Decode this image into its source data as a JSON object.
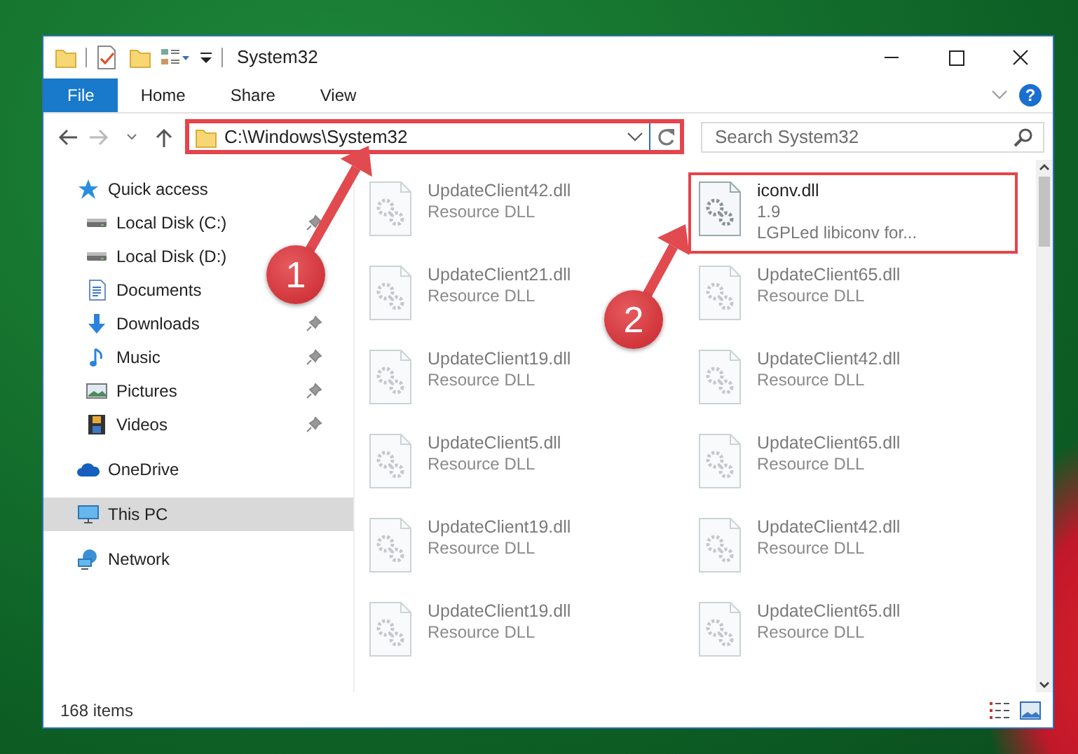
{
  "window": {
    "title": "System32"
  },
  "ribbon_tabs": [
    {
      "label": "File",
      "kind": "file"
    },
    {
      "label": "Home",
      "kind": "tab"
    },
    {
      "label": "Share",
      "kind": "tab"
    },
    {
      "label": "View",
      "kind": "tab"
    }
  ],
  "help_button": {
    "label": "?"
  },
  "address": {
    "path": "C:\\Windows\\System32",
    "highlighted": true
  },
  "search": {
    "placeholder": "Search System32"
  },
  "navigation": [
    {
      "label": "Quick access",
      "kind": "star",
      "selected": false,
      "children": [
        {
          "label": "Local Disk (C:)",
          "kind": "drive",
          "pinned": true,
          "selected": false
        },
        {
          "label": "Local Disk (D:)",
          "kind": "drive",
          "pinned": false,
          "selected": false
        },
        {
          "label": "Documents",
          "kind": "document",
          "pinned": false,
          "selected": false
        },
        {
          "label": "Downloads",
          "kind": "download",
          "pinned": true,
          "selected": false
        },
        {
          "label": "Music",
          "kind": "music",
          "pinned": true,
          "selected": false
        },
        {
          "label": "Pictures",
          "kind": "picture",
          "pinned": true,
          "selected": false
        },
        {
          "label": "Videos",
          "kind": "video",
          "pinned": true,
          "selected": false
        }
      ]
    },
    {
      "label": "OneDrive",
      "kind": "cloud",
      "selected": false
    },
    {
      "label": "This PC",
      "kind": "computer",
      "selected": true
    },
    {
      "label": "Network",
      "kind": "network",
      "selected": false
    }
  ],
  "files": [
    {
      "name": "UpdateClient42.dll",
      "details": [
        "Resource DLL"
      ],
      "highlighted": false
    },
    {
      "name": "iconv.dll",
      "details": [
        "1.9",
        "LGPLed libiconv for..."
      ],
      "highlighted": true
    },
    {
      "name": "UpdateClient21.dll",
      "details": [
        "Resource DLL"
      ],
      "highlighted": false
    },
    {
      "name": "UpdateClient65.dll",
      "details": [
        "Resource DLL"
      ],
      "highlighted": false
    },
    {
      "name": "UpdateClient19.dll",
      "details": [
        "Resource DLL"
      ],
      "highlighted": false
    },
    {
      "name": "UpdateClient42.dll",
      "details": [
        "Resource DLL"
      ],
      "highlighted": false
    },
    {
      "name": "UpdateClient5.dll",
      "details": [
        "Resource DLL"
      ],
      "highlighted": false
    },
    {
      "name": "UpdateClient65.dll",
      "details": [
        "Resource DLL"
      ],
      "highlighted": false
    },
    {
      "name": "UpdateClient19.dll",
      "details": [
        "Resource DLL"
      ],
      "highlighted": false
    },
    {
      "name": "UpdateClient42.dll",
      "details": [
        "Resource DLL"
      ],
      "highlighted": false
    },
    {
      "name": "UpdateClient19.dll",
      "details": [
        "Resource DLL"
      ],
      "highlighted": false
    },
    {
      "name": "UpdateClient65.dll",
      "details": [
        "Resource DLL"
      ],
      "highlighted": false
    }
  ],
  "status_bar": {
    "item_count": "168 items"
  },
  "callouts": [
    {
      "number": "1"
    },
    {
      "number": "2"
    }
  ]
}
